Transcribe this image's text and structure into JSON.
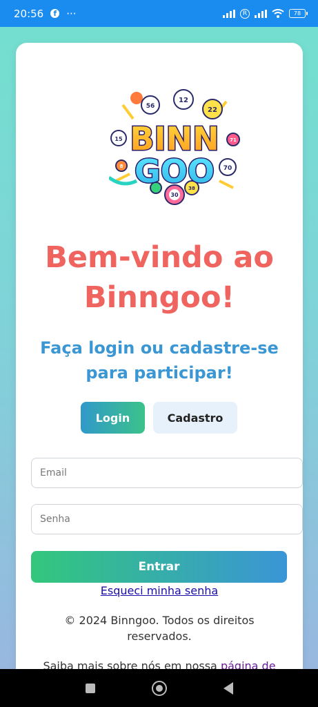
{
  "status_bar": {
    "time": "20:56",
    "fb_glyph": "f",
    "more": "···",
    "roaming": "R",
    "battery": "78"
  },
  "logo": {
    "word_top": "BINN",
    "word_bottom": "GOO",
    "balls": [
      "12",
      "22",
      "56",
      "15",
      "71",
      "8",
      "70",
      "30",
      "38"
    ]
  },
  "welcome_title_line1": "Bem-vindo ao",
  "welcome_title_line2": "Binngoo!",
  "subtitle_line1": "Faça login ou cadastre-se",
  "subtitle_line2": "para participar!",
  "tabs": {
    "login": "Login",
    "cadastro": "Cadastro"
  },
  "form": {
    "email_placeholder": "Email",
    "senha_placeholder": "Senha",
    "submit": "Entrar",
    "forgot": "Esqueci minha senha"
  },
  "footer": {
    "copyright_line1": "© 2024 Binngoo. Todos os direitos",
    "copyright_line2": "reservados.",
    "about_text": "Saiba mais sobre nós em nossa ",
    "about_link": "página de"
  },
  "colors": {
    "title": "#f0645f",
    "subtitle": "#3a97d4",
    "status_bar": "#1a8cf0"
  }
}
